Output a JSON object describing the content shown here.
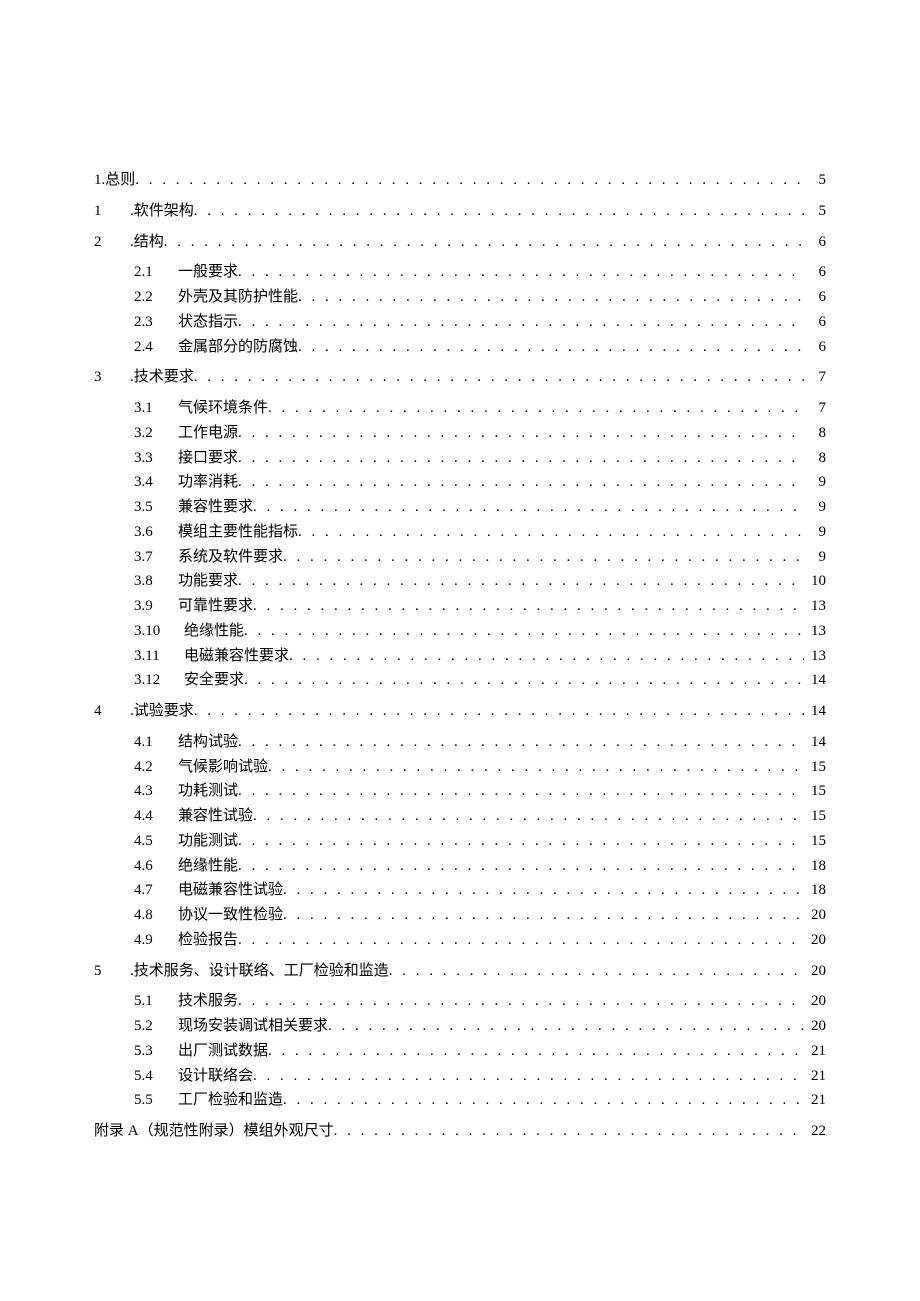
{
  "toc": {
    "s0": {
      "num": "1.",
      "title": "总则",
      "page": "5"
    },
    "s1": {
      "num": "1",
      "title": ".软件架构",
      "page": "5"
    },
    "s2": {
      "num": "2",
      "title": ".结构",
      "page": "6",
      "items": {
        "i1": {
          "sub": "2.1",
          "title": "一般要求",
          "page": "6"
        },
        "i2": {
          "sub": "2.2",
          "title": "外壳及其防护性能",
          "page": "6"
        },
        "i3": {
          "sub": "2.3",
          "title": "状态指示",
          "page": "6"
        },
        "i4": {
          "sub": "2.4",
          "title": "金属部分的防腐蚀",
          "page": "6"
        }
      }
    },
    "s3": {
      "num": "3",
      "title": ".技术要求",
      "page": "7",
      "items": {
        "i1": {
          "sub": "3.1",
          "title": "气候环境条件",
          "page": "7"
        },
        "i2": {
          "sub": "3.2",
          "title": "工作电源",
          "page": "8"
        },
        "i3": {
          "sub": "3.3",
          "title": "接口要求",
          "page": "8"
        },
        "i4": {
          "sub": "3.4",
          "title": "功率消耗",
          "page": "9"
        },
        "i5": {
          "sub": "3.5",
          "title": "兼容性要求",
          "page": "9"
        },
        "i6": {
          "sub": "3.6",
          "title": "模组主要性能指标",
          "page": "9"
        },
        "i7": {
          "sub": "3.7",
          "title": "系统及软件要求",
          "page": "9"
        },
        "i8": {
          "sub": "3.8",
          "title": "功能要求",
          "page": "10"
        },
        "i9": {
          "sub": "3.9",
          "title": "可靠性要求",
          "page": "13"
        },
        "i10": {
          "sub": "3.10",
          "title": "绝缘性能",
          "page": "13"
        },
        "i11": {
          "sub": "3.11",
          "title": "电磁兼容性要求",
          "page": "13"
        },
        "i12": {
          "sub": "3.12",
          "title": "安全要求",
          "page": "14"
        }
      }
    },
    "s4": {
      "num": "4",
      "title": ".试验要求",
      "page": "14",
      "items": {
        "i1": {
          "sub": "4.1",
          "title": "结构试验",
          "page": "14"
        },
        "i2": {
          "sub": "4.2",
          "title": "气候影响试验",
          "page": "15"
        },
        "i3": {
          "sub": "4.3",
          "title": "功耗测试",
          "page": "15"
        },
        "i4": {
          "sub": "4.4",
          "title": "兼容性试验",
          "page": "15"
        },
        "i5": {
          "sub": "4.5",
          "title": "功能测试",
          "page": "15"
        },
        "i6": {
          "sub": "4.6",
          "title": "绝缘性能",
          "page": "18"
        },
        "i7": {
          "sub": "4.7",
          "title": "电磁兼容性试验",
          "page": "18"
        },
        "i8": {
          "sub": "4.8",
          "title": "协议一致性检验",
          "page": "20"
        },
        "i9": {
          "sub": "4.9",
          "title": "检验报告",
          "page": "20"
        }
      }
    },
    "s5": {
      "num": "5",
      "title": ".技术服务、设计联络、工厂检验和监造",
      "page": "20",
      "items": {
        "i1": {
          "sub": "5.1",
          "title": "技术服务",
          "page": "20"
        },
        "i2": {
          "sub": "5.2",
          "title": "现场安装调试相关要求",
          "page": "20"
        },
        "i3": {
          "sub": "5.3",
          "title": "出厂测试数据",
          "page": "21"
        },
        "i4": {
          "sub": "5.4",
          "title": "设计联络会",
          "page": "21"
        },
        "i5": {
          "sub": "5.5",
          "title": "工厂检验和监造",
          "page": "21"
        }
      }
    },
    "appendix": {
      "title": "附录 A（规范性附录）模组外观尺寸",
      "page": "22"
    }
  }
}
